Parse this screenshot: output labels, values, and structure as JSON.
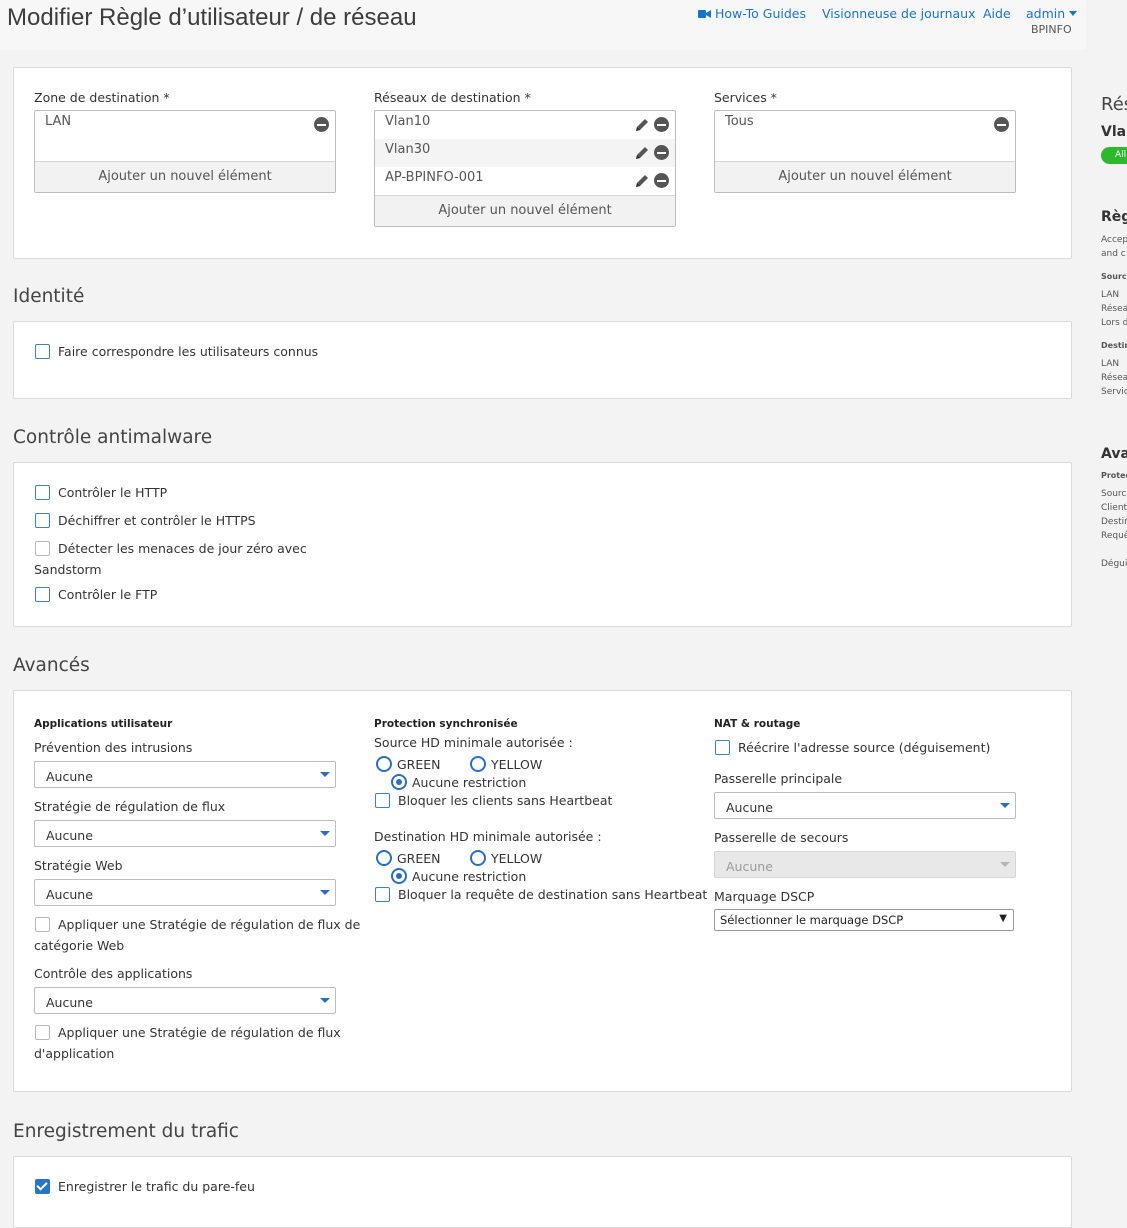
{
  "header": {
    "title": "Modifier Règle d’utilisateur / de réseau",
    "howto": "How-To Guides",
    "log_viewer": "Visionneuse de journaux",
    "help": "Aide",
    "admin": "admin",
    "device": "BPINFO"
  },
  "destination": {
    "zone_label": "Zone de destination *",
    "zone_items": [
      "LAN"
    ],
    "networks_label": "Réseaux de destination *",
    "network_items": [
      "Vlan10",
      "Vlan30",
      "AP-BPINFO-001"
    ],
    "services_label": "Services *",
    "service_items": [
      "Tous"
    ],
    "add_label": "Ajouter un nouvel élément"
  },
  "identity": {
    "title": "Identité",
    "match_known_users": "Faire correspondre les utilisateurs connus"
  },
  "antimalware": {
    "title": "Contrôle antimalware",
    "http": "Contrôler le HTTP",
    "https": "Déchiffrer et contrôler le HTTPS",
    "sandstorm_line1": "Détecter les menaces de jour zéro avec",
    "sandstorm_line2": "Sandstorm",
    "ftp": "Contrôler le FTP"
  },
  "advanced": {
    "title": "Avancés",
    "user_apps": {
      "heading": "Applications utilisateur",
      "ips_label": "Prévention des intrusions",
      "ips_value": "Aucune",
      "shaping_label": "Stratégie de régulation de flux",
      "shaping_value": "Aucune",
      "web_label": "Stratégie Web",
      "web_value": "Aucune",
      "web_shaping_line1": "Appliquer une Stratégie de régulation de flux de",
      "web_shaping_line2": "catégorie Web",
      "appctrl_label": "Contrôle des applications",
      "appctrl_value": "Aucune",
      "app_shaping_line1": "Appliquer une Stratégie de régulation de flux",
      "app_shaping_line2": "d'application"
    },
    "sync": {
      "heading": "Protection synchronisée",
      "source_label": "Source HD minimale autorisée :",
      "green": "GREEN",
      "yellow": "YELLOW",
      "no_restriction": "Aucune restriction",
      "block_source": "Bloquer les clients sans Heartbeat",
      "dest_label": "Destination HD minimale autorisée :",
      "block_dest": "Bloquer la requête de destination sans Heartbeat"
    },
    "nat": {
      "heading": "NAT & routage",
      "rewrite": "Réécrire l'adresse source (déguisement)",
      "primary_gw_label": "Passerelle principale",
      "primary_gw_value": "Aucune",
      "backup_gw_label": "Passerelle de secours",
      "backup_gw_value": "Aucune",
      "dscp_label": "Marquage DSCP",
      "dscp_value": "Sélectionner le marquage DSCP"
    }
  },
  "logging": {
    "title": "Enregistrement du trafic",
    "log_traffic": "Enregistrer le trafic du pare-feu"
  },
  "summary": {
    "title": "Rés",
    "rule_name": "Vlar",
    "badge": "All",
    "rule_heading": "Règ",
    "accept_1": "Accep",
    "accept_2": "and c",
    "source_heading": "Source",
    "src_1": "LAN",
    "src_2": "Résea",
    "src_3": "Lors d",
    "dest_heading": "Destin",
    "dst_1": "LAN",
    "dst_2": "Résea",
    "dst_3": "Servic",
    "adv_heading": "Ava",
    "protec": "Protec",
    "adv_1": "Sourc",
    "adv_2": "Client",
    "adv_3": "Destin",
    "adv_4": "Requê",
    "adv_5": "Dégui"
  },
  "colors": {
    "accent": "#2a6fbf",
    "link": "#1a73c8",
    "badge_green": "#2db92d"
  }
}
